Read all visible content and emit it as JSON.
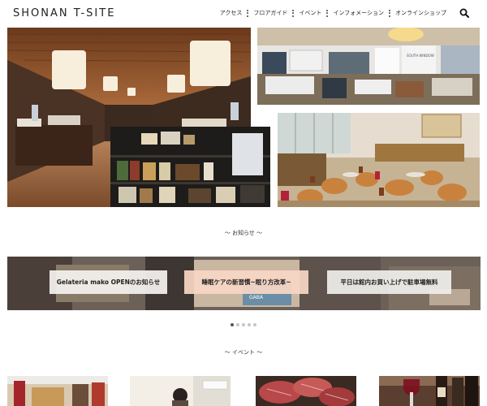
{
  "header": {
    "logo": "SHONAN T-SITE",
    "nav": [
      "アクセス",
      "フロアガイド",
      "イベント",
      "インフォメーション",
      "オンラインショップ"
    ]
  },
  "sections": {
    "news_title": "～ お知らせ ～",
    "event_title": "～ イベント ～"
  },
  "banner": {
    "items": [
      "Gelateria mako OPENのお知らせ",
      "睡眠ケアの新習慣~眠り方改革~",
      "平日は館内お買い上げで駐車場無料"
    ],
    "sign_text": "GABA",
    "slides": 5,
    "active_slide": 1
  },
  "photo2": {
    "sign_text": "SOUTH WINDOW"
  },
  "icons": {
    "search": "search-icon"
  },
  "colors": {
    "banner_pink": "#f8d6c4",
    "text": "#222222"
  }
}
